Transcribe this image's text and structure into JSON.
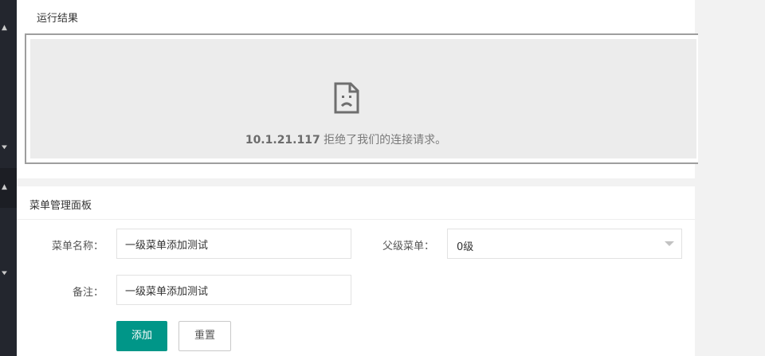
{
  "sidebar": {
    "caret_up": "▲",
    "caret_down": "▼"
  },
  "result_panel": {
    "title": "运行结果",
    "error": {
      "icon": "sad-page-icon",
      "host": "10.1.21.117",
      "message": " 拒绝了我们的连接请求。"
    }
  },
  "menu_panel": {
    "title": "菜单管理面板",
    "name_label": "菜单名称：",
    "name_value": "一级菜单添加测试",
    "parent_label": "父级菜单：",
    "parent_value": "0级",
    "remark_label": "备注：",
    "remark_value": "一级菜单添加测试",
    "add_button": "添加",
    "reset_button": "重置"
  },
  "colors": {
    "primary": "#009688",
    "sidebar": "#23262e"
  }
}
